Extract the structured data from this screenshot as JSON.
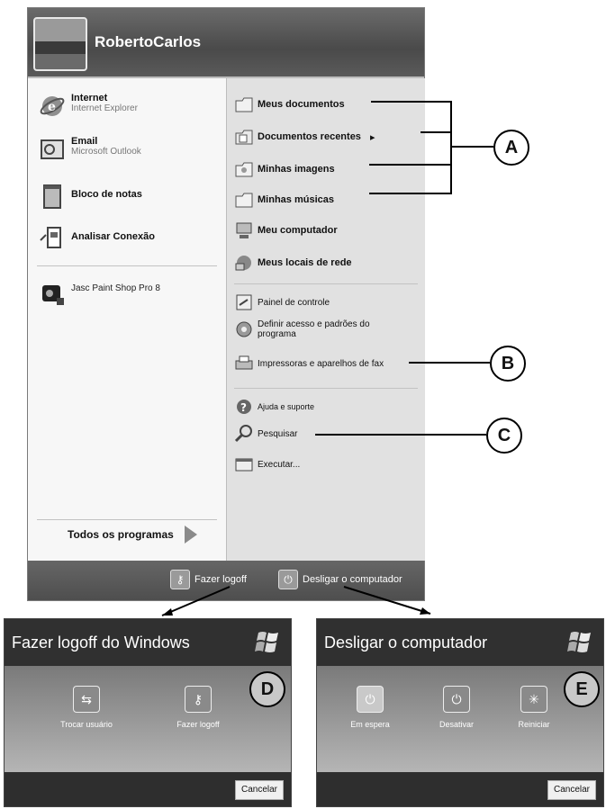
{
  "start_menu": {
    "username": "RobertoCarlos",
    "pinned": [
      {
        "title": "Internet",
        "subtitle": "Internet Explorer",
        "icon": "internet-explorer-icon"
      },
      {
        "title": "Email",
        "subtitle": "Microsoft Outlook",
        "icon": "outlook-icon"
      },
      {
        "title": "Bloco de notas",
        "subtitle": "",
        "icon": "notepad-icon"
      },
      {
        "title": "Analisar Conexão",
        "subtitle": "",
        "icon": "network-analyzer-icon"
      }
    ],
    "recent": [
      {
        "title": "Jasc Paint Shop Pro 8",
        "icon": "paint-shop-icon"
      }
    ],
    "all_programs": "Todos os programas",
    "right": {
      "documents": "Meus documentos",
      "recent_docs": "Documentos recentes",
      "recent_docs_arrow": "▸",
      "pictures": "Minhas imagens",
      "music": "Minhas músicas",
      "computer": "Meu computador",
      "network": "Meus locais de rede",
      "control_panel": "Painel de controle",
      "program_access": "Definir acesso e padrões do programa",
      "printers": "Impressoras e aparelhos de fax",
      "help": "Ajuda e suporte",
      "search": "Pesquisar",
      "run": "Executar..."
    },
    "footer": {
      "logoff": "Fazer logoff",
      "shutdown": "Desligar o computador"
    }
  },
  "callouts": {
    "a": "A",
    "b": "B",
    "c": "C",
    "d": "D",
    "e": "E"
  },
  "logoff_dialog": {
    "title": "Fazer logoff do Windows",
    "switch_user": "Trocar usuário",
    "logoff": "Fazer logoff",
    "cancel": "Cancelar"
  },
  "shutdown_dialog": {
    "title": "Desligar o computador",
    "standby": "Em espera",
    "turn_off": "Desativar",
    "restart": "Reiniciar",
    "cancel": "Cancelar"
  }
}
